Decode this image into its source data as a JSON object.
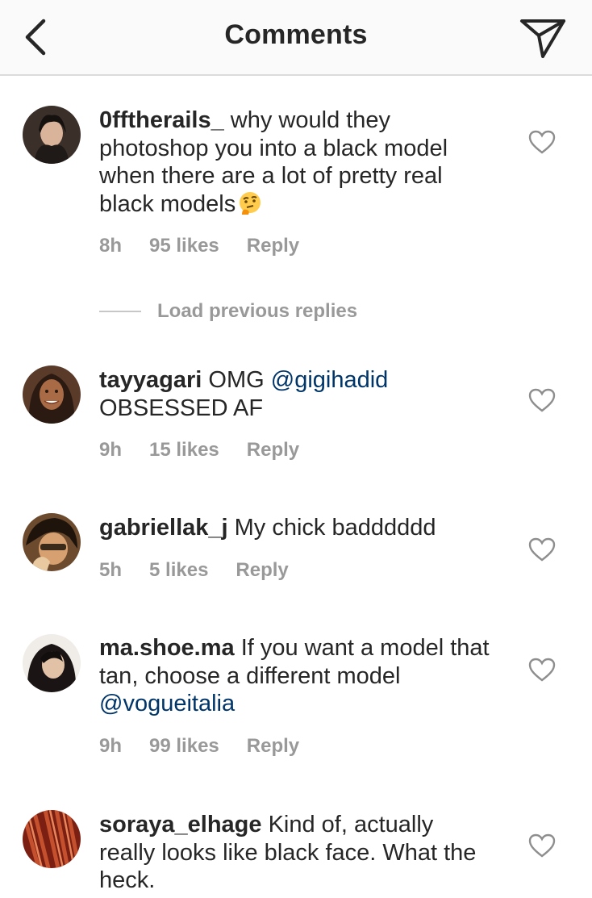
{
  "header": {
    "title": "Comments",
    "back_icon": "chevron-left-icon",
    "send_icon": "paper-plane-icon"
  },
  "comments": [
    {
      "username": "0fftherails_",
      "text": " why would they photoshop you into a black model when there are a lot of pretty real black models",
      "emoji": "thinking-face",
      "time": "8h",
      "likes": "95 likes",
      "reply": "Reply"
    },
    {
      "username": "tayyagari",
      "text": " OMG ",
      "mention": "@gigihadid",
      "text_after": " OBSESSED AF",
      "time": "9h",
      "likes": "15 likes",
      "reply": "Reply"
    },
    {
      "username": "gabriellak_j",
      "text": " My chick badddddd",
      "time": "5h",
      "likes": "5 likes",
      "reply": "Reply"
    },
    {
      "username": "ma.shoe.ma",
      "text": " If you want a model that tan, choose a different model ",
      "mention": "@vogueitalia",
      "time": "9h",
      "likes": "99 likes",
      "reply": "Reply"
    },
    {
      "username": "soraya_elhage",
      "text": " Kind of, actually really looks like black face. What the heck."
    }
  ],
  "load_previous": "Load previous replies",
  "colors": {
    "text": "#262626",
    "meta": "#999999",
    "mention": "#003569",
    "header_bg": "#fafafa",
    "divider": "#dbdbdb"
  }
}
